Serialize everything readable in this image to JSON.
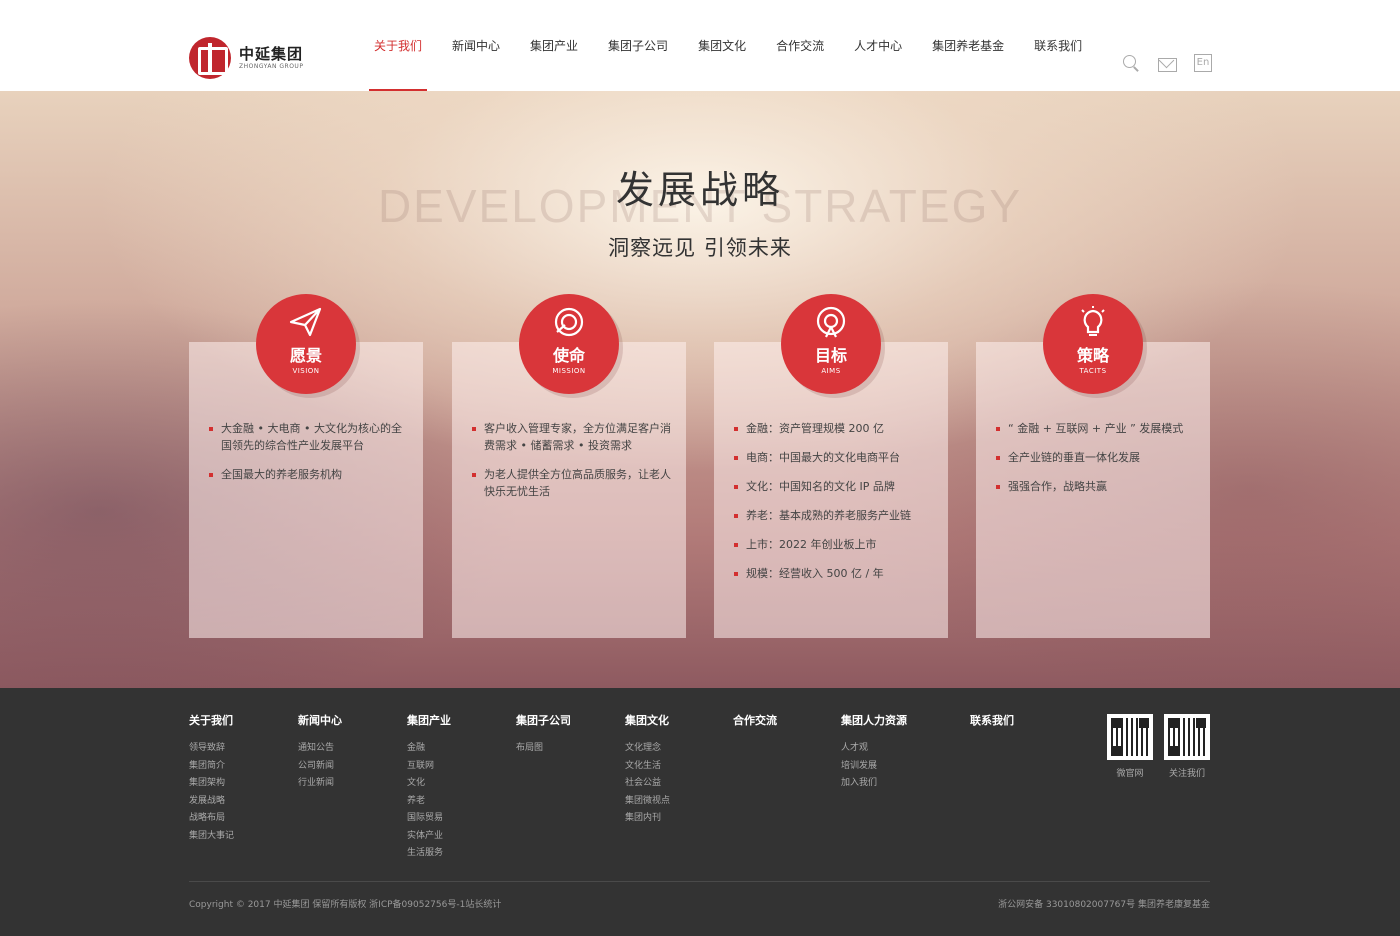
{
  "logo": {
    "cn": "中延集团",
    "en": "ZHONGYAN GROUP"
  },
  "nav": [
    "关于我们",
    "新闻中心",
    "集团产业",
    "集团子公司",
    "集团文化",
    "合作交流",
    "人才中心",
    "集团养老基金",
    "联系我们"
  ],
  "header_icons": {
    "search": "search-icon",
    "mail": "mail-icon",
    "lang": "En"
  },
  "hero": {
    "title": "发展战略",
    "bg_text": "DEVELOPMENT STRATEGY",
    "subtitle": "洞察远见 引领未来"
  },
  "cards": [
    {
      "cn": "愿景",
      "en": "VISION",
      "icon": "paper-plane-icon",
      "items": [
        "大金融 • 大电商 • 大文化为核心的全国领先的综合性产业发展平台",
        "全国最大的养老服务机构"
      ]
    },
    {
      "cn": "使命",
      "en": "MISSION",
      "icon": "target-icon",
      "items": [
        "客户收入管理专家，全方位满足客户消费需求 • 储蓄需求 • 投资需求",
        "为老人提供全方位高品质服务，让老人快乐无忧生活"
      ]
    },
    {
      "cn": "目标",
      "en": "AIMS",
      "icon": "signal-icon",
      "items": [
        "金融：资产管理规模 200 亿",
        "电商：中国最大的文化电商平台",
        "文化：中国知名的文化 IP 品牌",
        "养老：基本成熟的养老服务产业链",
        "上市：2022 年创业板上市",
        "规模：经营收入 500 亿 / 年"
      ]
    },
    {
      "cn": "策略",
      "en": "TACITS",
      "icon": "lightbulb-icon",
      "items": [
        "“ 金融 + 互联网 + 产业 ” 发展模式",
        "全产业链的垂直一体化发展",
        "强强合作，战略共赢"
      ]
    }
  ],
  "footer": {
    "columns": [
      {
        "title": "关于我们",
        "links": [
          "领导致辞",
          "集团简介",
          "集团架构",
          "发展战略",
          "战略布局",
          "集团大事记"
        ]
      },
      {
        "title": "新闻中心",
        "links": [
          "通知公告",
          "公司新闻",
          "行业新闻"
        ]
      },
      {
        "title": "集团产业",
        "links": [
          "金融",
          "互联网",
          "文化",
          "养老",
          "国际贸易",
          "实体产业",
          "生活服务"
        ]
      },
      {
        "title": "集团子公司",
        "links": [
          "布局图"
        ]
      },
      {
        "title": "集团文化",
        "links": [
          "文化理念",
          "文化生活",
          "社会公益",
          "集团微视点",
          "集团内刊"
        ]
      },
      {
        "title": "合作交流",
        "links": []
      },
      {
        "title": "集团人力资源",
        "links": [
          "人才观",
          "培训发展",
          "加入我们"
        ]
      },
      {
        "title": "联系我们",
        "links": []
      }
    ],
    "qr": [
      {
        "label": "微官网"
      },
      {
        "label": "关注我们"
      }
    ],
    "copyright": "Copyright © 2017 中延集团 保留所有版权 浙ICP备09052756号-1站长统计",
    "right_text": "浙公网安备 33010802007767号    集团养老康复基金"
  }
}
